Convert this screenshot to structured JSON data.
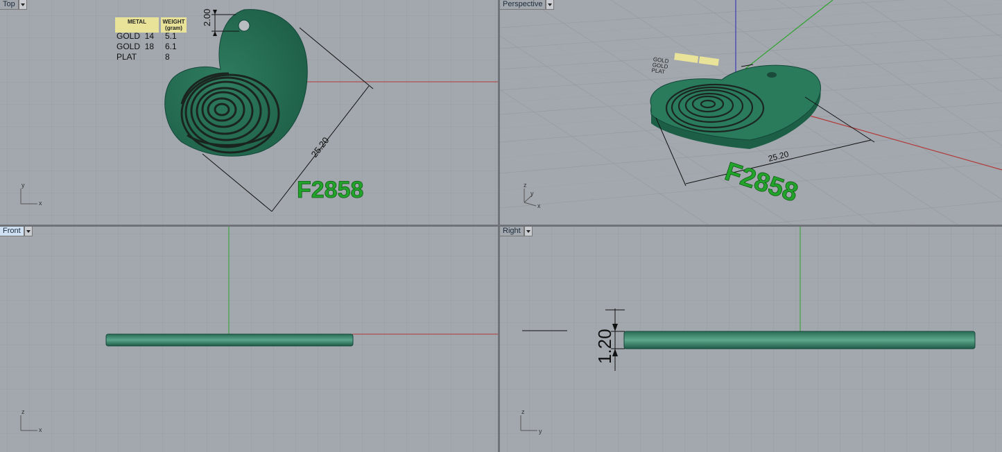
{
  "viewports": {
    "top": {
      "label": "Top",
      "axes": [
        "y",
        "x"
      ]
    },
    "perspective": {
      "label": "Perspective",
      "axes": [
        "z",
        "y",
        "x"
      ]
    },
    "front": {
      "label": "Front",
      "axes": [
        "z",
        "x"
      ]
    },
    "right": {
      "label": "Right",
      "axes": [
        "z",
        "y"
      ]
    }
  },
  "weight_table": {
    "headers": [
      "METAL",
      "WEIGHT (gram)"
    ],
    "header_metal": "METAL",
    "header_weight": "WEIGHT",
    "header_weight_unit": "(gram)",
    "rows": [
      {
        "metal": "GOLD",
        "karat": "14",
        "weight": "5.1"
      },
      {
        "metal": "GOLD",
        "karat": "18",
        "weight": "6.1"
      },
      {
        "metal": "PLAT",
        "karat": "",
        "weight": "8"
      }
    ]
  },
  "dimensions": {
    "hole_offset": "2.00",
    "width": "25.20",
    "thickness": "1.20"
  },
  "model_code": "F2858",
  "colors": {
    "viewport_bg": "#a3a8ae",
    "grid": "#949aa0",
    "pendant": "#1f6a4f",
    "pendant_light": "#3f8f72",
    "code_text": "#22a32a",
    "x_axis": "#b23a3a",
    "y_axis": "#2fa32f",
    "z_axis": "#3a3ab5",
    "active_tab": "#cfe0f3"
  }
}
